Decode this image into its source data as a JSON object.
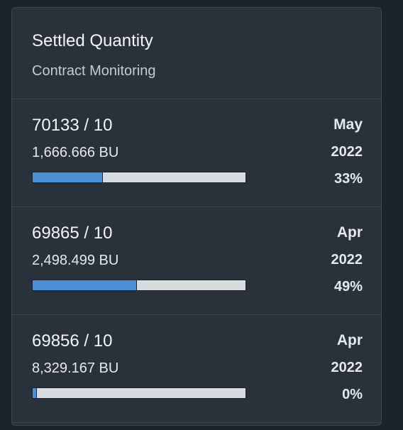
{
  "card": {
    "title": "Settled Quantity",
    "subtitle": "Contract Monitoring"
  },
  "rows": [
    {
      "contract": "70133 / 10",
      "quantity": "1,666.666 BU",
      "month": "May",
      "year": "2022",
      "percent_label": "33%",
      "progress": 0.33
    },
    {
      "contract": "69865 / 10",
      "quantity": "2,498.499 BU",
      "month": "Apr",
      "year": "2022",
      "percent_label": "49%",
      "progress": 0.49
    },
    {
      "contract": "69856 / 10",
      "quantity": "8,329.167 BU",
      "month": "Apr",
      "year": "2022",
      "percent_label": "0%",
      "progress": 0.0
    }
  ],
  "colors": {
    "progress_fill": "#4c8fd6",
    "progress_track": "#d9dcdf",
    "card_background": "#29313a"
  }
}
